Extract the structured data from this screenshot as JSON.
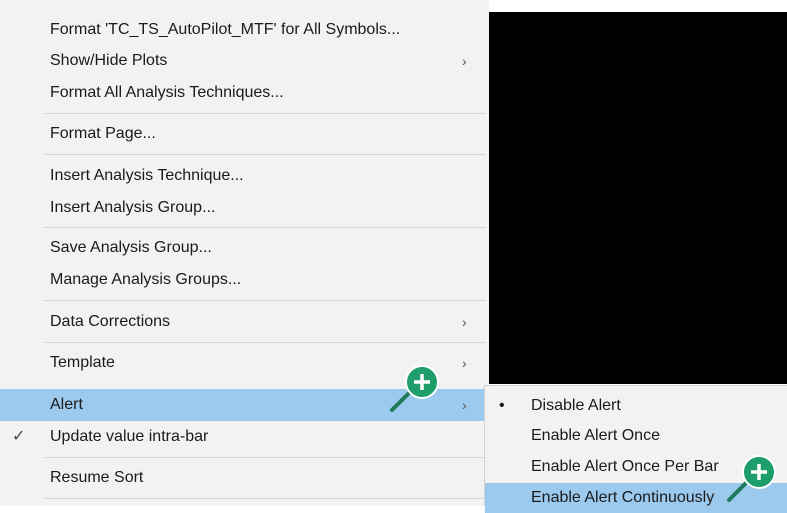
{
  "menu": {
    "items": [
      {
        "label": "Format 'TC_TS_AutoPilot_MTF' for All Symbols..."
      },
      {
        "label": "Show/Hide Plots",
        "arrow": "›"
      },
      {
        "label": "Format All Analysis Techniques..."
      },
      {
        "label": "Format Page..."
      },
      {
        "label": "Insert Analysis Technique..."
      },
      {
        "label": "Insert Analysis Group..."
      },
      {
        "label": "Save Analysis Group..."
      },
      {
        "label": "Manage Analysis Groups..."
      },
      {
        "label": "Data Corrections",
        "arrow": "›"
      },
      {
        "label": "Template",
        "arrow": "›"
      },
      {
        "label": "Alert",
        "arrow": "›"
      },
      {
        "label": "Update value intra-bar",
        "check": "✓"
      },
      {
        "label": "Resume Sort"
      }
    ]
  },
  "submenu": {
    "items": [
      {
        "label": "Disable Alert",
        "bullet": "•"
      },
      {
        "label": "Enable Alert Once"
      },
      {
        "label": "Enable Alert Once Per Bar"
      },
      {
        "label": "Enable Alert Continuously"
      }
    ]
  },
  "icons": {
    "zoom": "zoom-in-cursor-icon",
    "check": "checkmark-icon",
    "arrow": "chevron-right-icon",
    "bullet": "bullet-icon"
  },
  "colors": {
    "highlight": "#9cc9ee",
    "menu_bg": "#f2f2f2",
    "zoom_green": "#1e9e6a"
  }
}
